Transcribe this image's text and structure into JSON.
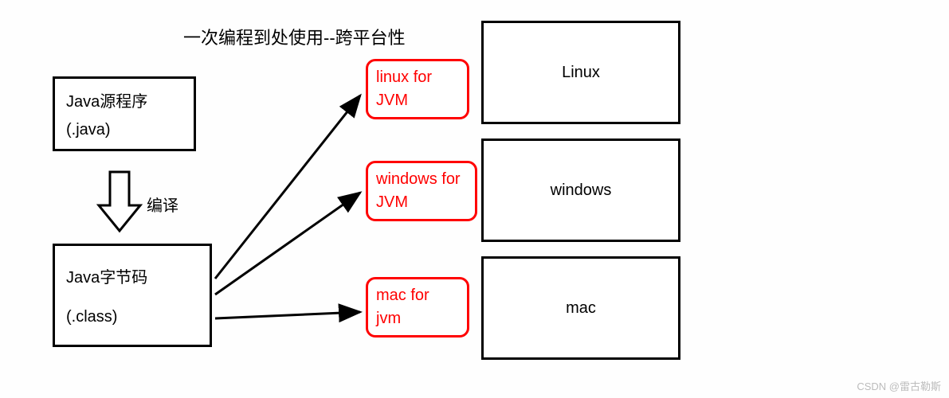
{
  "title": "一次编程到处使用--跨平台性",
  "source_box": {
    "line1": "Java源程序",
    "line2": "(.java)"
  },
  "compile_label": "编译",
  "bytecode_box": {
    "line1": "Java字节码",
    "line2": "(.class)"
  },
  "jvm_boxes": [
    {
      "line1": "linux for",
      "line2": "JVM"
    },
    {
      "line1": "windows for",
      "line2": "JVM"
    },
    {
      "line1": "mac for",
      "line2": "jvm"
    }
  ],
  "platform_boxes": [
    "Linux",
    "windows",
    "mac"
  ],
  "watermark": "CSDN @雷古勒斯"
}
